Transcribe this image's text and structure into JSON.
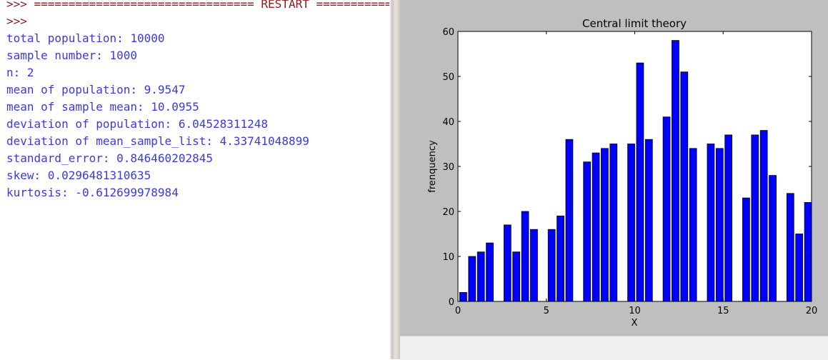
{
  "shell": {
    "lines": [
      {
        "text": ">>> ================================ RESTART ================================",
        "kind": "prompt"
      },
      {
        "text": ">>> ",
        "kind": "prompt"
      },
      {
        "text": "total population: 10000",
        "kind": "out"
      },
      {
        "text": "sample number: 1000",
        "kind": "out"
      },
      {
        "text": "n: 2",
        "kind": "out"
      },
      {
        "text": "mean of population: 9.9547",
        "kind": "out"
      },
      {
        "text": "mean of sample mean: 10.0955",
        "kind": "out"
      },
      {
        "text": "deviation of population: 6.04528311248",
        "kind": "out"
      },
      {
        "text": "deviation of mean_sample_list: 4.33741048899",
        "kind": "out"
      },
      {
        "text": "standard_error: 0.846460202845",
        "kind": "out"
      },
      {
        "text": "skew: 0.0296481310635",
        "kind": "out"
      },
      {
        "text": "kurtosis: -0.612699978984",
        "kind": "out"
      }
    ],
    "colors": {
      "prompt": "#8a1c1c",
      "out": "#3b3bd8"
    }
  },
  "figure": {
    "background": "#bfbfbf",
    "toolbar_color": "#efefef"
  },
  "chart_data": {
    "type": "bar",
    "title": "Central limit theory",
    "xlabel": "X",
    "ylabel": "frenquency",
    "xlim": [
      0,
      20
    ],
    "ylim": [
      0,
      60
    ],
    "xticks": [
      "0",
      "5",
      "10",
      "15",
      "20"
    ],
    "yticks": [
      "0",
      "10",
      "20",
      "30",
      "40",
      "50",
      "60"
    ],
    "bar_width": 0.4,
    "bar_color": "#0000ff",
    "series": [
      {
        "x": [
          0.5,
          1.0,
          1.5,
          2.0,
          2.5,
          3.0,
          3.5,
          4.0,
          4.5,
          5.0,
          5.5,
          6.0,
          6.5,
          7.0,
          7.5,
          8.0,
          8.5,
          9.0,
          9.5,
          10.0,
          10.5,
          11.0,
          11.5,
          12.0,
          12.5,
          13.0,
          13.5,
          14.0,
          14.5,
          15.0,
          15.5,
          16.0,
          16.5,
          17.0,
          17.5,
          18.0,
          18.5,
          19.0,
          19.5,
          20.0
        ],
        "values": [
          2,
          10,
          11,
          13,
          0,
          17,
          11,
          20,
          16,
          0,
          16,
          19,
          36,
          0,
          31,
          33,
          34,
          35,
          0,
          35,
          53,
          36,
          0,
          41,
          58,
          51,
          34,
          0,
          35,
          34,
          37,
          0,
          23,
          37,
          38,
          28,
          0,
          24,
          15,
          22
        ]
      }
    ]
  }
}
